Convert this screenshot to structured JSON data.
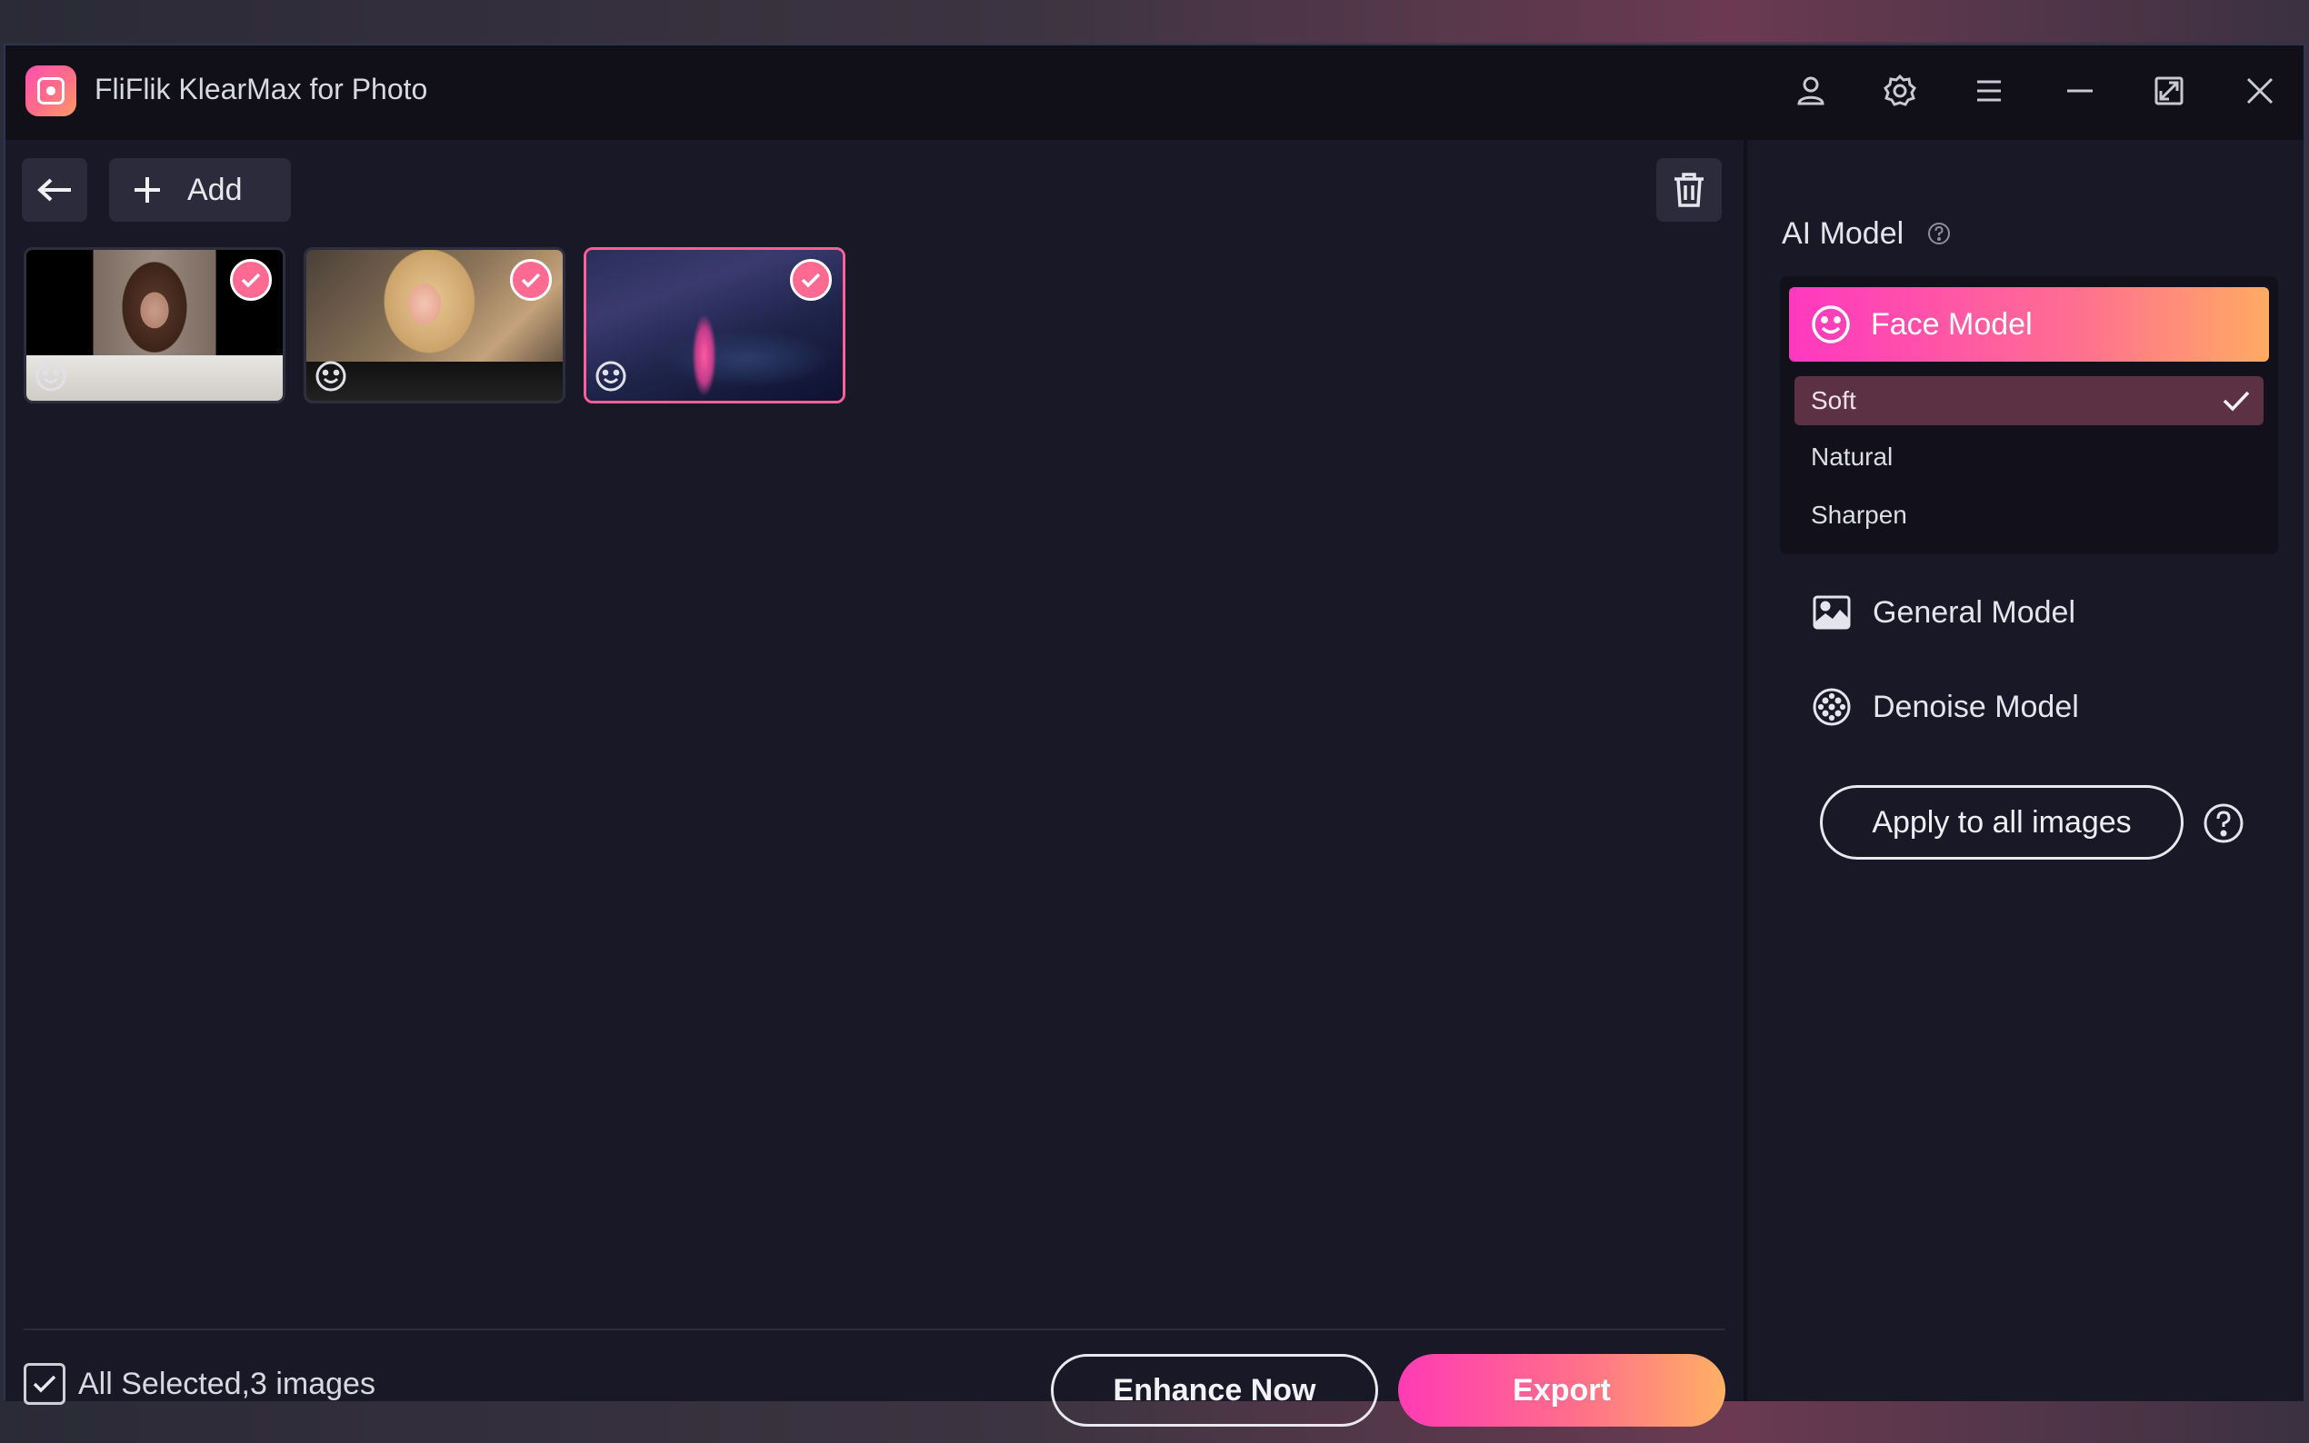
{
  "window": {
    "title": "FliFlik KlearMax for Photo"
  },
  "toolbar": {
    "add_label": "Add"
  },
  "thumbnails": [
    {
      "name": "portrait-1",
      "selected": true
    },
    {
      "name": "portrait-2",
      "selected": true
    },
    {
      "name": "night-city-aerial",
      "selected": true,
      "current": true
    }
  ],
  "footer": {
    "selection_label": "All Selected,3 images",
    "enhance_label": "Enhance Now",
    "export_label": "Export"
  },
  "sidebar": {
    "title": "AI Model",
    "face_model": {
      "label": "Face Model",
      "options": [
        "Soft",
        "Natural",
        "Sharpen"
      ],
      "selected": "Soft"
    },
    "general_model_label": "General Model",
    "denoise_model_label": "Denoise Model",
    "apply_label": "Apply to all images"
  },
  "colors": {
    "accent_start": "#ff38c0",
    "accent_end": "#ffab63",
    "background": "#191827",
    "selected_option": "#5b3143"
  },
  "icons": [
    "user-icon",
    "settings-icon",
    "menu-icon",
    "minimize-icon",
    "maximize-icon",
    "close-icon",
    "back-arrow-icon",
    "plus-icon",
    "trash-icon",
    "check-icon",
    "face-icon",
    "help-icon",
    "image-icon",
    "denoise-icon"
  ]
}
